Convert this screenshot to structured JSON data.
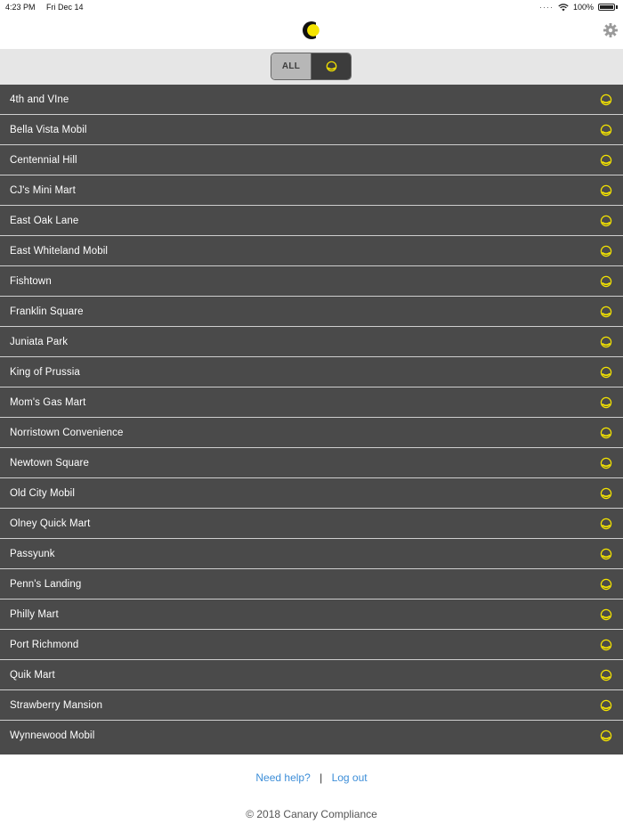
{
  "status_bar": {
    "time": "4:23 PM",
    "date": "Fri Dec 14",
    "battery": "100%"
  },
  "header": {
    "logo_icon": "canary-logo-icon",
    "settings_icon": "gear-icon"
  },
  "filter": {
    "all_label": "ALL",
    "canary_icon": "canary-ring-icon",
    "selected": "canary"
  },
  "stores": [
    "4th and VIne",
    "Bella Vista Mobil",
    "Centennial Hill",
    "CJ's Mini Mart",
    "East Oak Lane",
    "East Whiteland Mobil",
    "Fishtown",
    "Franklin Square",
    "Juniata Park",
    "King of Prussia",
    "Mom's Gas Mart",
    "Norristown Convenience",
    "Newtown Square",
    "Old City Mobil",
    "Olney Quick Mart",
    "Passyunk",
    "Penn's Landing",
    "Philly Mart",
    "Port Richmond",
    "Quik Mart",
    "Strawberry Mansion",
    "Wynnewood Mobil"
  ],
  "footer": {
    "help_label": "Need help?",
    "separator": "|",
    "logout_label": "Log out",
    "copyright": "© 2018 Canary Compliance"
  },
  "colors": {
    "accent_yellow": "#f5e400",
    "row_background": "#4a4a4a",
    "link_blue": "#3d8ed8"
  }
}
